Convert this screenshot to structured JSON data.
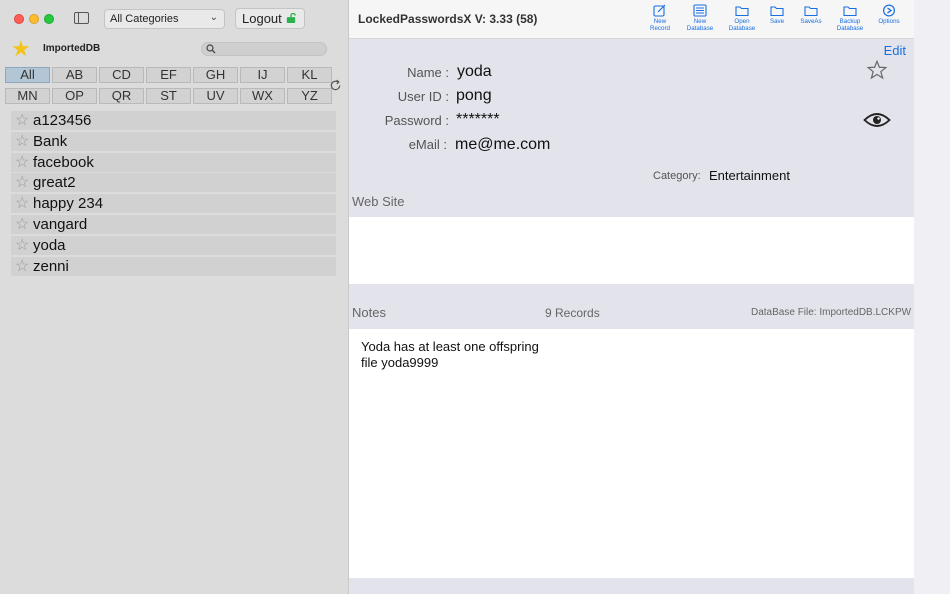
{
  "window": {
    "title": "LockedPasswordsX V: 3.33 (58)"
  },
  "sidebar": {
    "category_select": "All Categories",
    "logout_label": "Logout",
    "database_name": "ImportedDB",
    "search_placeholder": "",
    "alphabet_row1": [
      "All",
      "AB",
      "CD",
      "EF",
      "GH",
      "IJ",
      "KL"
    ],
    "alphabet_row2": [
      "MN",
      "OP",
      "QR",
      "ST",
      "UV",
      "WX",
      "YZ"
    ],
    "active_filter": "All",
    "records": [
      "a123456",
      "Bank",
      "facebook",
      "great2",
      "happy 234",
      "vangard",
      "yoda",
      "zenni"
    ]
  },
  "toolbar": {
    "new_record": [
      "New",
      "Record"
    ],
    "new_database": [
      "New",
      "Database"
    ],
    "open_database": [
      "Open",
      "Database"
    ],
    "save": "Save",
    "save_as": "SaveAs",
    "backup_database": [
      "Backup",
      "Database"
    ],
    "options": "Options"
  },
  "detail": {
    "edit_label": "Edit",
    "name_label": "Name :",
    "name_value": "yoda",
    "userid_label": "User ID :",
    "userid_value": "pong",
    "password_label": "Password :",
    "password_value": "*******",
    "email_label": "eMail :",
    "email_value": "me@me.com",
    "category_label": "Category:",
    "category_value": "Entertainment",
    "website_label": "Web Site",
    "website_value": "",
    "notes_label": "Notes",
    "records_count": "9 Records",
    "database_file": "DataBase File: ImportedDB.LCKPW",
    "notes_lines": [
      "Yoda has at least one offspring",
      "file yoda9999"
    ]
  },
  "colors": {
    "accent": "#1a6fe0",
    "favorite_star": "#f2c318",
    "active_filter": "#b2c6d6"
  }
}
